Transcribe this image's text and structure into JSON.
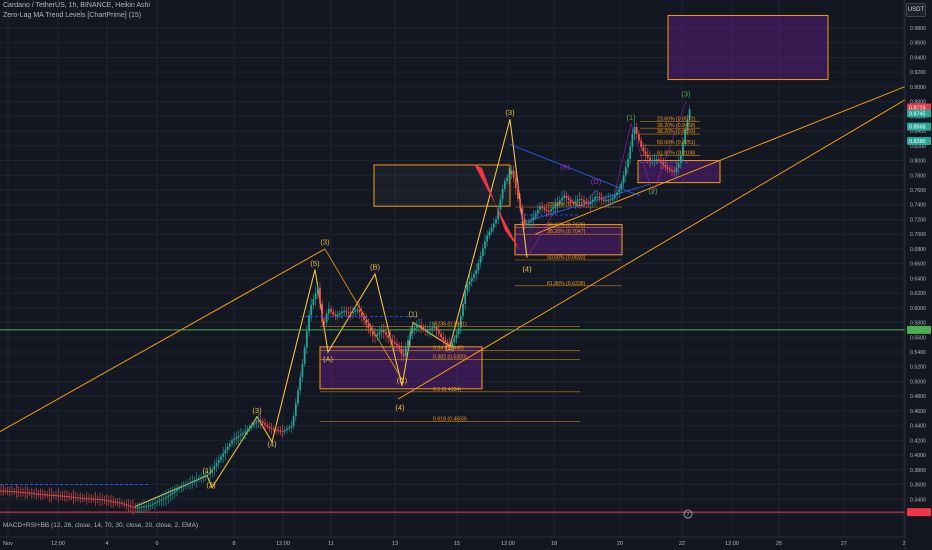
{
  "header": {
    "line1": "Cardano / TetherUS, 1h, BINANCE, Heikin Ashi",
    "line2": "Zero-Lag MA Trend Levels [ChartPrime] (15)",
    "currency": "USDT"
  },
  "indicator_label": "MACD+RSI+BB (12, 26, close, 14, 70, 30, close, 20, close, 2, EMA)",
  "colors": {
    "background": "#131722",
    "bull": "#26a69a",
    "bear": "#ef5350",
    "wave": "#f0c040",
    "trendline": "#f39c12",
    "fib": "#f39c12",
    "support_green": "#4caf50",
    "support_red": "#f23645",
    "box_purple": "#7b1fa2",
    "corrective": "#9c27b0"
  },
  "chart_data": {
    "type": "candlestick",
    "title": "Cardano / TetherUS, 1h, BINANCE, Heikin Ashi",
    "ylim": [
      0.31,
      1.02
    ],
    "yticks": [
      0.32,
      0.34,
      0.36,
      0.38,
      0.4,
      0.42,
      0.44,
      0.46,
      0.48,
      0.5,
      0.52,
      0.54,
      0.56,
      0.58,
      0.6,
      0.62,
      0.64,
      0.66,
      0.68,
      0.7,
      0.72,
      0.74,
      0.76,
      0.78,
      0.8,
      0.82,
      0.84,
      0.86,
      0.88,
      0.9,
      0.92,
      0.94,
      0.96,
      0.98
    ],
    "ytick_labels": [
      "0.3200",
      "0.3400",
      "0.3600",
      "0.3800",
      "0.4000",
      "0.4200",
      "0.4400",
      "0.4600",
      "0.4800",
      "0.5000",
      "0.5200",
      "0.5400",
      "0.5600",
      "0.5800",
      "0.6000",
      "0.6200",
      "0.6400",
      "0.6600",
      "0.6800",
      "0.7000",
      "0.7200",
      "0.7400",
      "0.7600",
      "0.7800",
      "0.8000",
      "0.8200",
      "0.8400",
      "0.8600",
      "0.8800",
      "0.9000",
      "0.9200",
      "0.9400",
      "0.9600",
      "0.9800"
    ],
    "xlim": [
      0,
      905
    ],
    "xticks": [
      {
        "x": 8,
        "label": "Nov"
      },
      {
        "x": 58,
        "label": "12:00"
      },
      {
        "x": 107,
        "label": "4"
      },
      {
        "x": 157,
        "label": "6"
      },
      {
        "x": 234,
        "label": "8"
      },
      {
        "x": 283,
        "label": "12:00"
      },
      {
        "x": 331,
        "label": "11"
      },
      {
        "x": 395,
        "label": "13"
      },
      {
        "x": 457,
        "label": "15"
      },
      {
        "x": 508,
        "label": "12:00"
      },
      {
        "x": 554,
        "label": "18"
      },
      {
        "x": 620,
        "label": "20"
      },
      {
        "x": 682,
        "label": "22"
      },
      {
        "x": 732,
        "label": "12:00"
      },
      {
        "x": 779,
        "label": "25"
      },
      {
        "x": 844,
        "label": "27"
      },
      {
        "x": 904,
        "label": "2"
      }
    ],
    "price_path": [
      [
        0,
        0.352
      ],
      [
        20,
        0.35
      ],
      [
        40,
        0.347
      ],
      [
        60,
        0.345
      ],
      [
        80,
        0.342
      ],
      [
        100,
        0.34
      ],
      [
        120,
        0.335
      ],
      [
        135,
        0.328
      ],
      [
        150,
        0.332
      ],
      [
        165,
        0.342
      ],
      [
        180,
        0.356
      ],
      [
        195,
        0.366
      ],
      [
        210,
        0.376
      ],
      [
        222,
        0.4
      ],
      [
        232,
        0.42
      ],
      [
        245,
        0.432
      ],
      [
        258,
        0.448
      ],
      [
        270,
        0.436
      ],
      [
        282,
        0.432
      ],
      [
        292,
        0.44
      ],
      [
        302,
        0.52
      ],
      [
        310,
        0.6
      ],
      [
        318,
        0.628
      ],
      [
        323,
        0.572
      ],
      [
        328,
        0.6
      ],
      [
        335,
        0.588
      ],
      [
        343,
        0.596
      ],
      [
        350,
        0.592
      ],
      [
        358,
        0.598
      ],
      [
        366,
        0.578
      ],
      [
        374,
        0.56
      ],
      [
        382,
        0.57
      ],
      [
        390,
        0.556
      ],
      [
        398,
        0.548
      ],
      [
        403,
        0.532
      ],
      [
        410,
        0.566
      ],
      [
        418,
        0.578
      ],
      [
        426,
        0.568
      ],
      [
        434,
        0.575
      ],
      [
        442,
        0.558
      ],
      [
        450,
        0.548
      ],
      [
        458,
        0.568
      ],
      [
        466,
        0.628
      ],
      [
        476,
        0.65
      ],
      [
        486,
        0.695
      ],
      [
        496,
        0.72
      ],
      [
        504,
        0.77
      ],
      [
        512,
        0.788
      ],
      [
        518,
        0.748
      ],
      [
        524,
        0.712
      ],
      [
        532,
        0.72
      ],
      [
        540,
        0.738
      ],
      [
        548,
        0.73
      ],
      [
        556,
        0.74
      ],
      [
        564,
        0.752
      ],
      [
        572,
        0.742
      ],
      [
        580,
        0.748
      ],
      [
        588,
        0.74
      ],
      [
        596,
        0.752
      ],
      [
        604,
        0.745
      ],
      [
        612,
        0.748
      ],
      [
        620,
        0.762
      ],
      [
        628,
        0.802
      ],
      [
        634,
        0.848
      ],
      [
        642,
        0.815
      ],
      [
        650,
        0.8
      ],
      [
        658,
        0.802
      ],
      [
        666,
        0.79
      ],
      [
        674,
        0.784
      ],
      [
        680,
        0.8
      ],
      [
        685,
        0.84
      ],
      [
        690,
        0.872
      ]
    ],
    "current_price": "0.8719",
    "price_labels": [
      "0.8719",
      "0.8745",
      "0.8568",
      "0.8280"
    ],
    "elliott_labels": [
      {
        "x": 325,
        "y": 0.686,
        "text": "(3)",
        "color": "#f0c040"
      },
      {
        "x": 315,
        "y": 0.657,
        "text": "(5)",
        "color": "#f0c040"
      },
      {
        "x": 375,
        "y": 0.652,
        "text": "(B)",
        "color": "#f0c040"
      },
      {
        "x": 328,
        "y": 0.527,
        "text": "(A)",
        "color": "#f0c040"
      },
      {
        "x": 402,
        "y": 0.498,
        "text": "(C)",
        "color": "#f0c040"
      },
      {
        "x": 400,
        "y": 0.461,
        "text": "(4)",
        "color": "#f0c040"
      },
      {
        "x": 413,
        "y": 0.588,
        "text": "(1)",
        "color": "#f0c040"
      },
      {
        "x": 450,
        "y": 0.543,
        "text": "(2)",
        "color": "#f0c040"
      },
      {
        "x": 510,
        "y": 0.862,
        "text": "(3)",
        "color": "#f0c040"
      },
      {
        "x": 527,
        "y": 0.649,
        "text": "(4)",
        "color": "#f0c040"
      },
      {
        "x": 207,
        "y": 0.376,
        "text": "(1)",
        "color": "#f0c040"
      },
      {
        "x": 211,
        "y": 0.356,
        "text": "(2)",
        "color": "#f0c040"
      },
      {
        "x": 257,
        "y": 0.457,
        "text": "(3)",
        "color": "#f0c040"
      },
      {
        "x": 272,
        "y": 0.412,
        "text": "(4)",
        "color": "#f0c040"
      },
      {
        "x": 565,
        "y": 0.788,
        "text": "(B)",
        "color": "#9c27b0"
      },
      {
        "x": 596,
        "y": 0.768,
        "text": "(D)",
        "color": "#9c27b0"
      },
      {
        "x": 631,
        "y": 0.855,
        "text": "(1)",
        "color": "#4caf50"
      },
      {
        "x": 653,
        "y": 0.755,
        "text": "(2)",
        "color": "#4caf50"
      },
      {
        "x": 686,
        "y": 0.887,
        "text": "(3)",
        "color": "#4caf50"
      }
    ],
    "fib_levels": [
      {
        "x": 433,
        "y": 0.579,
        "text": "0.236 (0.5801)"
      },
      {
        "x": 433,
        "y": 0.546,
        "text": "0.34 (0.5448)"
      },
      {
        "x": 433,
        "y": 0.534,
        "text": "0.382 (0.5300)"
      },
      {
        "x": 433,
        "y": 0.49,
        "text": "0.5 (0.4904)"
      },
      {
        "x": 433,
        "y": 0.45,
        "text": "0.618 (0.4503)"
      },
      {
        "x": 547,
        "y": 0.741,
        "text": "23.60% (0.7411)"
      },
      {
        "x": 547,
        "y": 0.713,
        "text": "38.20% (0.7128)"
      },
      {
        "x": 547,
        "y": 0.704,
        "text": "38.20% (0.7047)"
      },
      {
        "x": 547,
        "y": 0.669,
        "text": "50.00% (0.6693)"
      },
      {
        "x": 547,
        "y": 0.634,
        "text": "61.80% (0.6338)"
      },
      {
        "x": 657,
        "y": 0.857,
        "text": "23.60% (0.8572)"
      },
      {
        "x": 657,
        "y": 0.848,
        "text": "38.20% (0.8458)"
      },
      {
        "x": 657,
        "y": 0.84,
        "text": "38.20% (0.8393)"
      },
      {
        "x": 657,
        "y": 0.825,
        "text": "50.00% (0.8251)"
      },
      {
        "x": 657,
        "y": 0.811,
        "text": "61.80% (0.8108)"
      }
    ],
    "horizontal_lines": [
      {
        "y": 0.57,
        "color": "#4caf50"
      },
      {
        "y": 0.3225,
        "color": "#f23645"
      }
    ],
    "boxes": [
      {
        "x1": 374,
        "x2": 510,
        "y1": 0.738,
        "y2": 0.794,
        "color": "#f39c12",
        "fill": "rgba(120,123,134,0.08)"
      },
      {
        "x1": 668,
        "x2": 828,
        "y1": 0.91,
        "y2": 0.997,
        "color": "#f39c12",
        "fill": "rgba(123,31,162,0.35)"
      },
      {
        "x1": 320,
        "x2": 482,
        "y1": 0.49,
        "y2": 0.547,
        "color": "#f39c12",
        "fill": "rgba(123,31,162,0.35)"
      },
      {
        "x1": 515,
        "x2": 622,
        "y1": 0.672,
        "y2": 0.713,
        "color": "#f39c12",
        "fill": "rgba(123,31,162,0.35)"
      },
      {
        "x1": 638,
        "x2": 720,
        "y1": 0.77,
        "y2": 0.8,
        "color": "#f39c12",
        "fill": "rgba(123,31,162,0.35)"
      }
    ],
    "badge": "7"
  }
}
